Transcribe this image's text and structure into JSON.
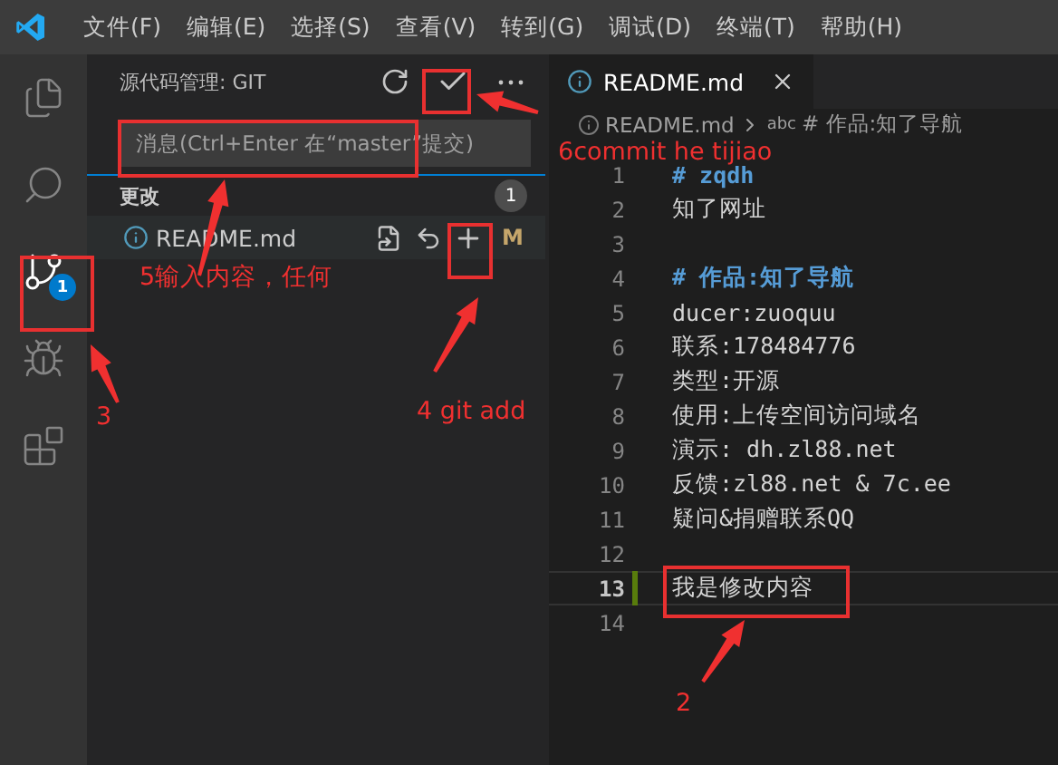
{
  "menu": [
    "文件(F)",
    "编辑(E)",
    "选择(S)",
    "查看(V)",
    "转到(G)",
    "调试(D)",
    "终端(T)",
    "帮助(H)"
  ],
  "activity_bar": [
    {
      "kind": "files",
      "selected": false
    },
    {
      "kind": "search",
      "selected": false
    },
    {
      "kind": "scm",
      "selected": true,
      "badge": "1"
    },
    {
      "kind": "debug",
      "selected": false
    },
    {
      "kind": "extensions",
      "selected": false
    }
  ],
  "sidebar": {
    "title": "源代码管理: GIT",
    "message": {
      "placeholder": "消息(Ctrl+Enter 在“master”提交)"
    },
    "changes": {
      "title": "更改",
      "count": "1",
      "files": [
        {
          "name": "README.md",
          "status": "M"
        }
      ]
    }
  },
  "editor": {
    "tab": {
      "label": "README.md"
    },
    "breadcrumb": [
      "README.md",
      "abc",
      "# 作品:知了导航"
    ],
    "lines": [
      {
        "number": "1",
        "text": "# zqdh",
        "kind": "heading",
        "modified": false,
        "current": false
      },
      {
        "number": "2",
        "text": "知了网址",
        "kind": "text",
        "modified": false,
        "current": false
      },
      {
        "number": "3",
        "modified": false,
        "current": false
      },
      {
        "number": "4",
        "text": "# 作品:知了导航",
        "kind": "heading",
        "modified": false,
        "current": false
      },
      {
        "number": "5",
        "text": "ducer:zuoquu",
        "kind": "text",
        "modified": false,
        "current": false
      },
      {
        "number": "6",
        "text": "联系:178484776",
        "kind": "text",
        "modified": false,
        "current": false
      },
      {
        "number": "7",
        "text": "类型:开源",
        "kind": "text",
        "modified": false,
        "current": false
      },
      {
        "number": "8",
        "text": "使用:上传空间访问域名",
        "kind": "text",
        "modified": false,
        "current": false
      },
      {
        "number": "9",
        "text": "演示: dh.zl88.net",
        "kind": "text",
        "modified": false,
        "current": false
      },
      {
        "number": "10",
        "text": "反馈:zl88.net & 7c.ee",
        "kind": "text",
        "modified": false,
        "current": false
      },
      {
        "number": "11",
        "text": "疑问&捐赠联系QQ",
        "kind": "text",
        "modified": false,
        "current": false
      },
      {
        "number": "12",
        "modified": false,
        "current": false
      },
      {
        "number": "13",
        "text": "我是修改内容",
        "kind": "text",
        "modified": true,
        "current": true
      },
      {
        "number": "14",
        "modified": false,
        "current": false
      }
    ]
  },
  "annotations": [
    "6commit he tijiao",
    "5输入内容，任何",
    "4 git add",
    "3",
    "2"
  ]
}
